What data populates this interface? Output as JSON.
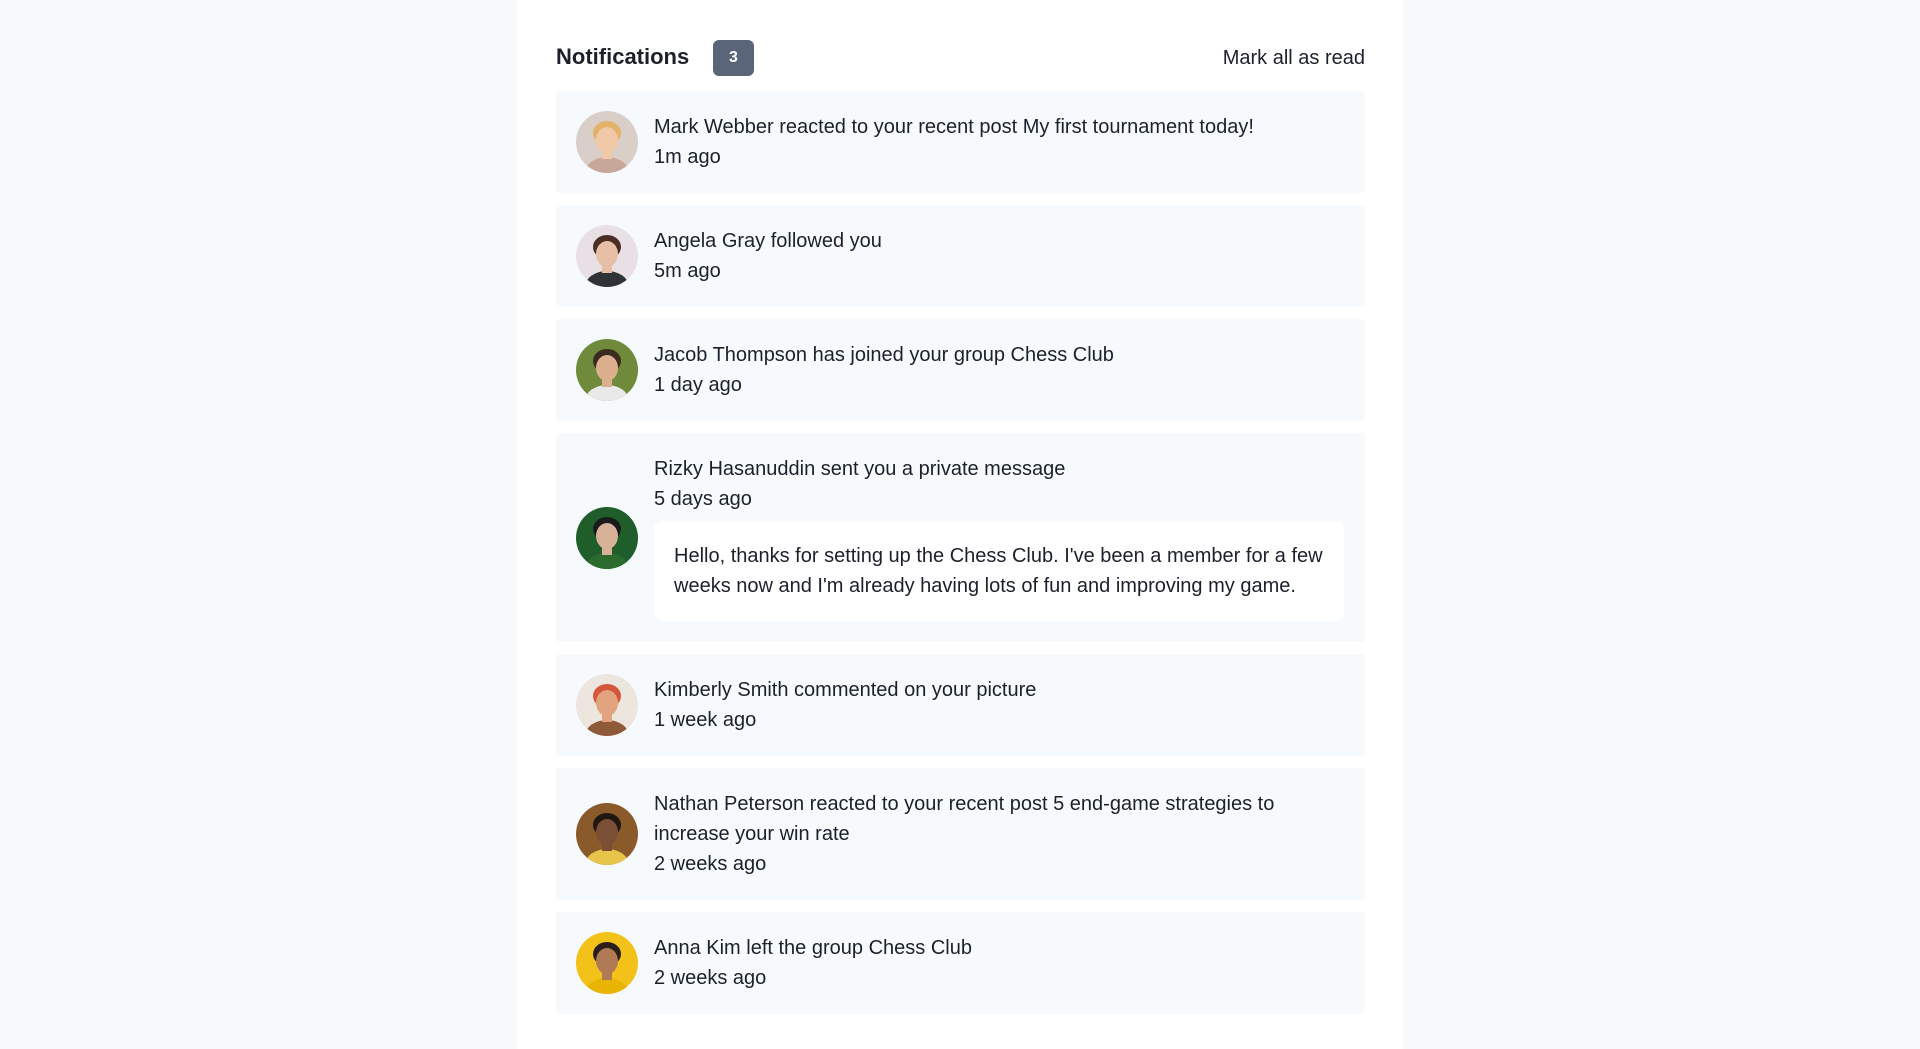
{
  "header": {
    "title": "Notifications",
    "unread_count": "3",
    "mark_all_label": "Mark all as read"
  },
  "notifications": [
    {
      "text": "Mark Webber reacted to your recent post My first tournament today!",
      "time": "1m ago",
      "avatar": {
        "bg": "#d9cfc8",
        "skin": "#f2c9a8",
        "hair": "#e2b26b",
        "shirt": "#c7a79a"
      }
    },
    {
      "text": "Angela Gray followed you",
      "time": "5m ago",
      "avatar": {
        "bg": "#e8e0e4",
        "skin": "#e6bfa6",
        "hair": "#4a2e26",
        "shirt": "#303238"
      }
    },
    {
      "text": "Jacob Thompson has joined your group Chess Club",
      "time": "1 day ago",
      "avatar": {
        "bg": "#6f8a3a",
        "skin": "#dcb08e",
        "hair": "#3b2a1f",
        "shirt": "#e9e9e9"
      }
    },
    {
      "text": "Rizky Hasanuddin sent you a private message",
      "time": "5 days ago",
      "message": "Hello, thanks for setting up the Chess Club. I've been a member for a few weeks now and I'm already having lots of fun and improving my game.",
      "avatar": {
        "bg": "#1f5e2a",
        "skin": "#d7b198",
        "hair": "#1b1b1b",
        "shirt": "#2c6b2f"
      }
    },
    {
      "text": "Kimberly Smith commented on your picture",
      "time": "1 week ago",
      "avatar": {
        "bg": "#ece6df",
        "skin": "#e2a47f",
        "hair": "#d4573b",
        "shirt": "#8f5a3a"
      }
    },
    {
      "text": "Nathan Peterson reacted to your recent post 5 end-game strategies to increase your win rate",
      "time": "2 weeks ago",
      "avatar": {
        "bg": "#8a5a2a",
        "skin": "#7a4f35",
        "hair": "#1f1712",
        "shirt": "#e7c44a"
      }
    },
    {
      "text": "Anna Kim left the group Chess Club",
      "time": "2 weeks ago",
      "avatar": {
        "bg": "#f2c21a",
        "skin": "#b07a55",
        "hair": "#2a1e18",
        "shirt": "#e9b400"
      }
    }
  ]
}
